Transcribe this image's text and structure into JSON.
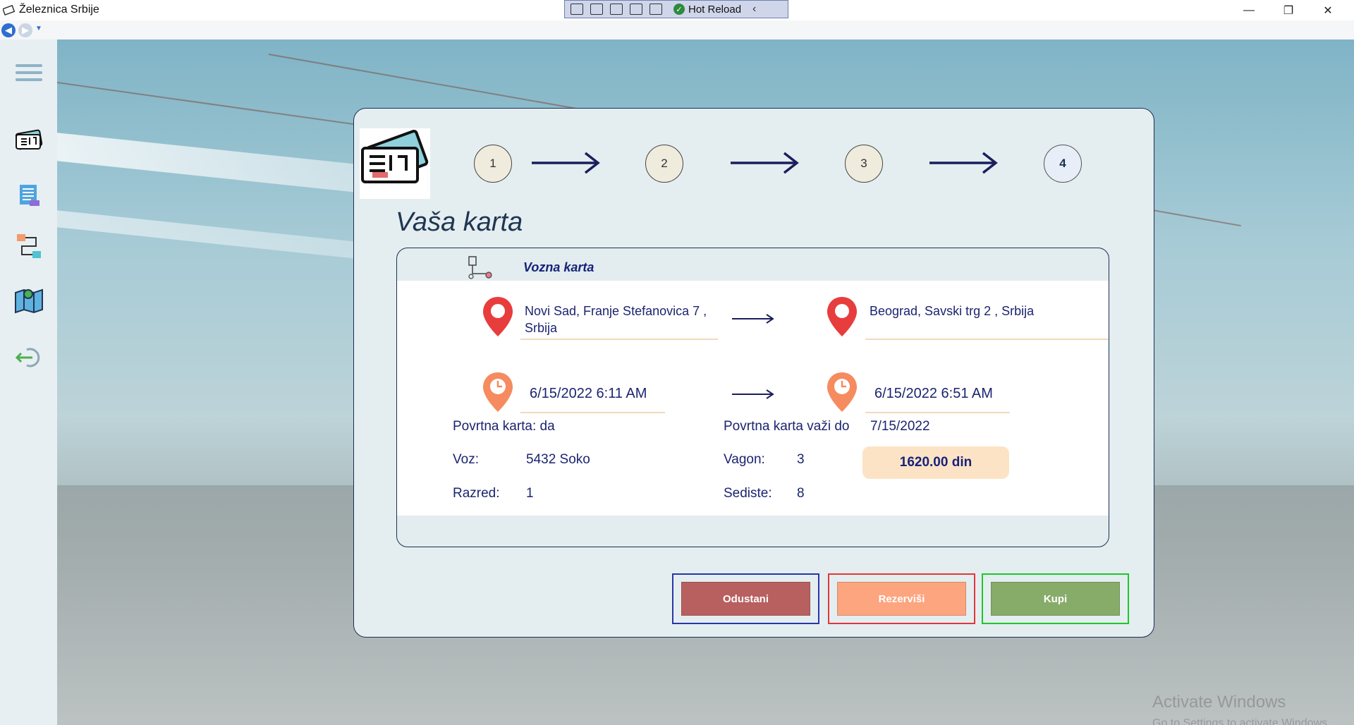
{
  "window": {
    "title": "Železnica Srbije",
    "hot_reload_label": "Hot Reload",
    "minimize": "—",
    "restore": "❐",
    "close": "✕"
  },
  "watermark": {
    "line1": "Activate Windows",
    "line2": "Go to Settings to activate Windows."
  },
  "sidebar": {
    "items": [
      {
        "name": "menu",
        "icon": "hamburger-icon"
      },
      {
        "name": "tickets",
        "icon": "ticket-icon"
      },
      {
        "name": "timetable",
        "icon": "list-icon"
      },
      {
        "name": "routes",
        "icon": "route-icon"
      },
      {
        "name": "map",
        "icon": "map-icon"
      },
      {
        "name": "logout",
        "icon": "logout-icon"
      }
    ]
  },
  "steps": [
    "1",
    "2",
    "3",
    "4"
  ],
  "active_step": 4,
  "heading": "Vaša karta",
  "ticket": {
    "header": "Vozna karta",
    "from_address": "Novi Sad, Franje Stefanovica 7 , Srbija",
    "to_address": "Beograd, Savski trg 2 , Srbija",
    "departure": "6/15/2022 6:11 AM",
    "arrival": "6/15/2022 6:51 AM",
    "return_label": "Povrtna karta: da",
    "return_valid_label": "Povrtna karta važi do",
    "return_valid_value": "7/15/2022",
    "train_label": "Voz:",
    "train_value": "5432 Soko",
    "class_label": "Razred:",
    "class_value": "1",
    "wagon_label": "Vagon:",
    "wagon_value": "3",
    "seat_label": "Sediste:",
    "seat_value": "8",
    "price": "1620.00 din"
  },
  "buttons": {
    "cancel": "Odustani",
    "reserve": "Rezerviši",
    "buy": "Kupi"
  },
  "colors": {
    "cancel": "#b85f5f",
    "reserve": "#fca57f",
    "buy": "#87ac69",
    "accent_text": "#17237a"
  }
}
